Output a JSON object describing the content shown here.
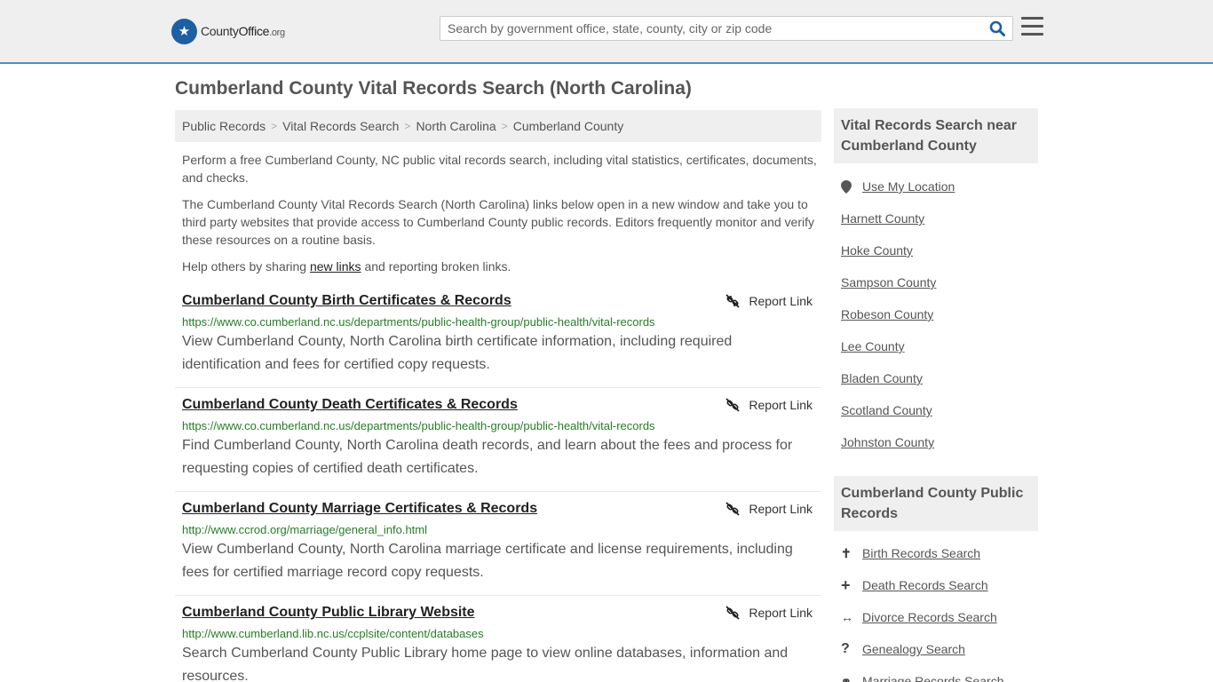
{
  "header": {
    "logo_name": "County",
    "logo_name_bold": "Office",
    "logo_tld": ".org",
    "search_placeholder": "Search by government office, state, county, city or zip code"
  },
  "page_title": "Cumberland County Vital Records Search (North Carolina)",
  "breadcrumb": [
    "Public Records",
    "Vital Records Search",
    "North Carolina",
    "Cumberland County"
  ],
  "breadcrumb_sep": ">",
  "intro": {
    "p1": "Perform a free Cumberland County, NC public vital records search, including vital statistics, certificates, documents, and checks.",
    "p2": "The Cumberland County Vital Records Search (North Carolina) links below open in a new window and take you to third party websites that provide access to Cumberland County public records. Editors frequently monitor and verify these resources on a routine basis.",
    "p3_before": "Help others by sharing ",
    "p3_link": "new links",
    "p3_after": " and reporting broken links."
  },
  "report_label": "Report Link",
  "results": [
    {
      "title": "Cumberland County Birth Certificates & Records",
      "url": "https://www.co.cumberland.nc.us/departments/public-health-group/public-health/vital-records",
      "desc": "View Cumberland County, North Carolina birth certificate information, including required identification and fees for certified copy requests."
    },
    {
      "title": "Cumberland County Death Certificates & Records",
      "url": "https://www.co.cumberland.nc.us/departments/public-health-group/public-health/vital-records",
      "desc": "Find Cumberland County, North Carolina death records, and learn about the fees and process for requesting copies of certified death certificates."
    },
    {
      "title": "Cumberland County Marriage Certificates & Records",
      "url": "http://www.ccrod.org/marriage/general_info.html",
      "desc": "View Cumberland County, North Carolina marriage certificate and license requirements, including fees for certified marriage record copy requests."
    },
    {
      "title": "Cumberland County Public Library Website",
      "url": "http://www.cumberland.lib.nc.us/ccplsite/content/databases",
      "desc": "Search Cumberland County Public Library home page to view online databases, information and resources."
    }
  ],
  "sidebar": {
    "nearby_heading": "Vital Records Search near Cumberland County",
    "use_location": "Use My Location",
    "nearby": [
      "Harnett County",
      "Hoke County",
      "Sampson County",
      "Robeson County",
      "Lee County",
      "Bladen County",
      "Scotland County",
      "Johnston County"
    ],
    "public_heading": "Cumberland County Public Records",
    "public_links": [
      {
        "icon": "person-icon",
        "glyph": "✝",
        "label": "Birth Records Search"
      },
      {
        "icon": "plus-icon",
        "glyph": "+",
        "label": "Death Records Search"
      },
      {
        "icon": "arrows-icon",
        "glyph": "↔",
        "label": "Divorce Records Search"
      },
      {
        "icon": "question-icon",
        "glyph": "?",
        "label": "Genealogy Search"
      },
      {
        "icon": "rings-icon",
        "glyph": "⚭",
        "label": "Marriage Records Search"
      }
    ]
  }
}
